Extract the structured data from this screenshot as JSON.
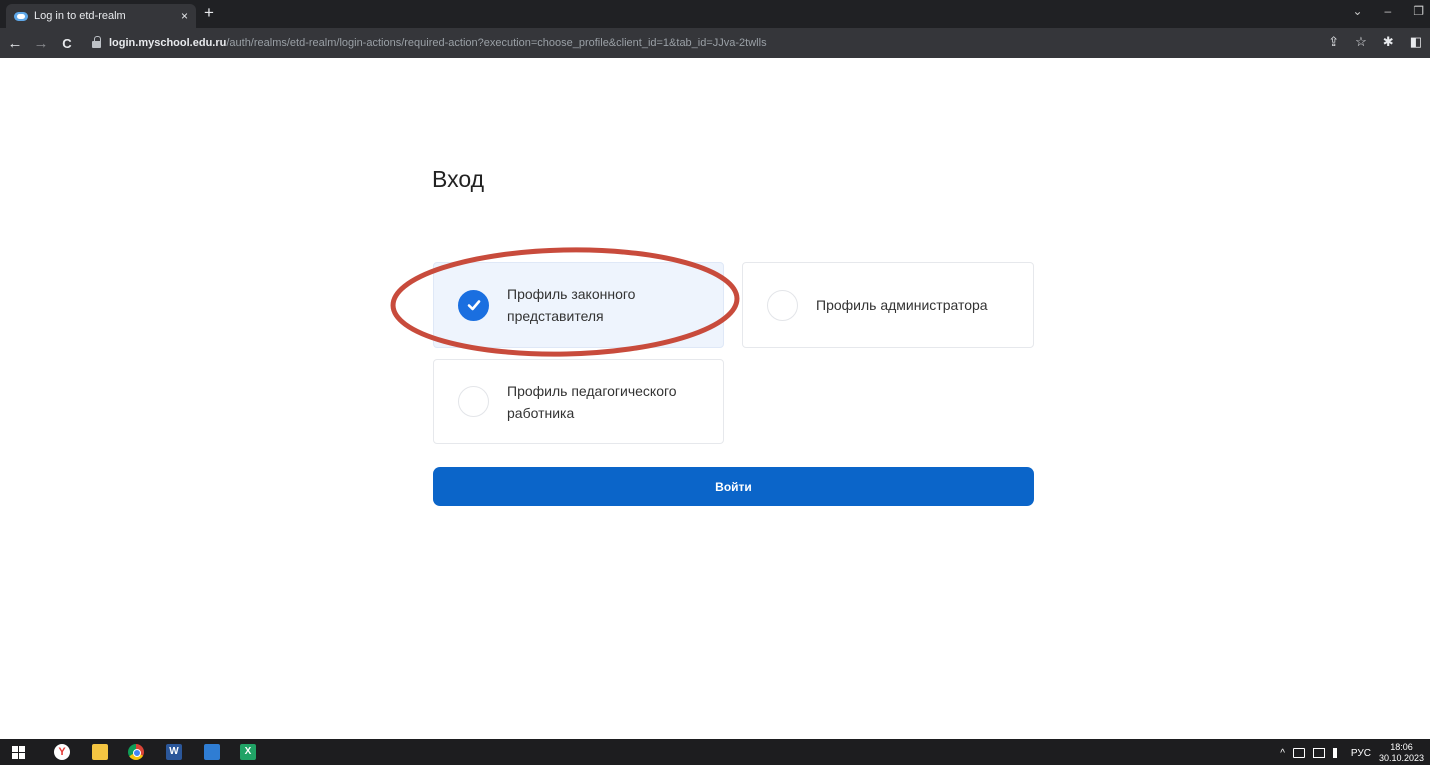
{
  "browser": {
    "tab_title": "Log in to etd-realm",
    "tab_close": "×",
    "new_tab": "+",
    "url_host": "login.myschool.edu.ru",
    "url_path": "/auth/realms/etd-realm/login-actions/required-action?execution=choose_profile&client_id=1&tab_id=JJva-2twlls",
    "back": "←",
    "forward": "→",
    "reload": "C",
    "share": "⇪",
    "star": "☆",
    "extensions": "✱",
    "sidepanel": "◧",
    "minimize": "–",
    "restore": "❐",
    "chevron": "⌄"
  },
  "page": {
    "title": "Вход",
    "profiles": [
      {
        "label": "Профиль законного представителя",
        "selected": true
      },
      {
        "label": "Профиль администратора",
        "selected": false
      },
      {
        "label": "Профиль педагогического работника",
        "selected": false
      }
    ],
    "submit_label": "Войти",
    "accent_color": "#0b65c9",
    "annotation_color": "#c84b3c"
  },
  "taskbar": {
    "yandex": "Y",
    "word": "W",
    "excel": "X",
    "language": "РУС",
    "time": "18:06",
    "date": "30.10.2023",
    "tray_chevron": "^"
  }
}
